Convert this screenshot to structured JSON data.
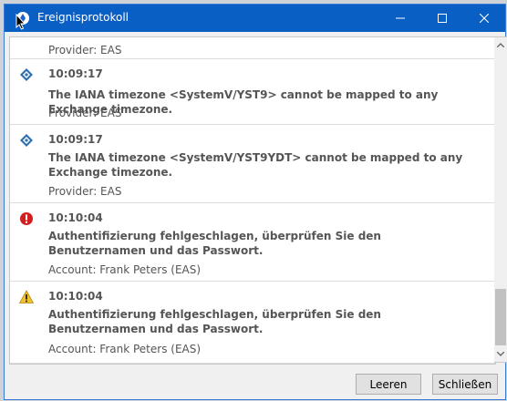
{
  "window": {
    "title": "Ereignisprotokoll"
  },
  "entries": [
    {
      "kind": "partial",
      "meta": "Provider: EAS"
    },
    {
      "kind": "info",
      "time": "10:09:17",
      "message": "The IANA timezone <SystemV/YST9> cannot be mapped to any Exchange timezone.",
      "meta": "Provider: EAS"
    },
    {
      "kind": "info",
      "time": "10:09:17",
      "message": "The IANA timezone <SystemV/YST9YDT> cannot be mapped to any Exchange timezone.",
      "meta": "Provider: EAS"
    },
    {
      "kind": "error",
      "time": "10:10:04",
      "message": "Authentifizierung fehlgeschlagen, überprüfen Sie den Benutzernamen und das Passwort.",
      "meta": "Account: Frank Peters (EAS)"
    },
    {
      "kind": "warning",
      "time": "10:10:04",
      "message": "Authentifizierung fehlgeschlagen, überprüfen Sie den Benutzernamen und das Passwort.",
      "meta": "Account: Frank Peters (EAS)"
    }
  ],
  "buttons": {
    "clear": "Leeren",
    "close": "Schließen"
  },
  "colors": {
    "titlebar": "#0a5fc4",
    "info": "#2a6fb0",
    "error": "#d21f1f",
    "warning": "#f2c12e"
  }
}
